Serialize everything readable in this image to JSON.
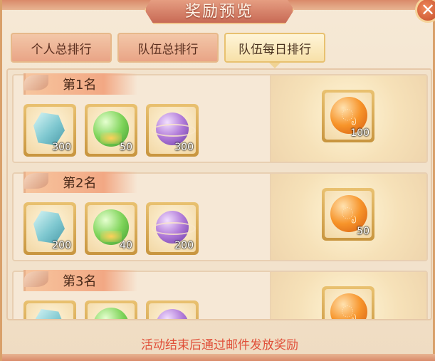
{
  "window": {
    "title": "奖励预览",
    "close_icon": "close-icon"
  },
  "tabs": [
    {
      "label": "个人总排行",
      "active": false
    },
    {
      "label": "队伍总排行",
      "active": false
    },
    {
      "label": "队伍每日排行",
      "active": true
    }
  ],
  "ranks": [
    {
      "label": "第1名",
      "items": [
        {
          "icon": "crystal-icon",
          "count": "300"
        },
        {
          "icon": "green-orb-icon",
          "count": "50"
        },
        {
          "icon": "purple-orb-icon",
          "count": "300"
        }
      ],
      "special": {
        "icon": "fire-orb-icon",
        "count": "100"
      }
    },
    {
      "label": "第2名",
      "items": [
        {
          "icon": "crystal-icon",
          "count": "200"
        },
        {
          "icon": "green-orb-icon",
          "count": "40"
        },
        {
          "icon": "purple-orb-icon",
          "count": "200"
        }
      ],
      "special": {
        "icon": "fire-orb-icon",
        "count": "50"
      }
    },
    {
      "label": "第3名",
      "items": [
        {
          "icon": "crystal-icon",
          "count": ""
        },
        {
          "icon": "green-orb-icon",
          "count": ""
        },
        {
          "icon": "purple-orb-icon",
          "count": ""
        }
      ],
      "special": {
        "icon": "fire-orb-icon",
        "count": ""
      }
    }
  ],
  "footer": {
    "notice": "活动结束后通过邮件发放奖励"
  },
  "colors": {
    "accent": "#e9a486",
    "notice": "#e0503a",
    "gold": "#e9c170"
  }
}
